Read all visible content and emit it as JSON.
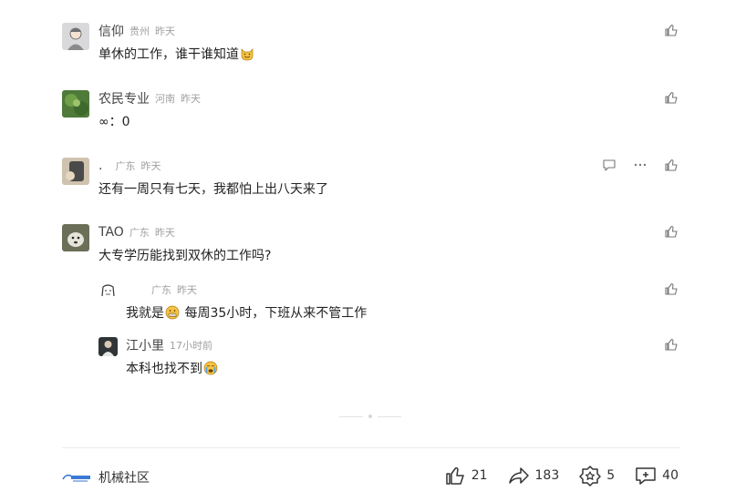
{
  "comments": [
    {
      "name": "信仰",
      "location": "贵州",
      "time": "昨天",
      "text_a": "单休的工作，谁干谁知道",
      "text_b": "",
      "emoji": "cat-grin"
    },
    {
      "name": "农民专业",
      "location": "河南",
      "time": "昨天",
      "text_a": "∞：0",
      "text_b": "",
      "emoji": ""
    },
    {
      "name": ".",
      "location": "广东",
      "time": "昨天",
      "text_a": "还有一周只有七天，我都怕上出八天来了",
      "text_b": "",
      "emoji": ""
    },
    {
      "name": "TAO",
      "location": "广东",
      "time": "昨天",
      "text_a": "大专学历能找到双休的工作吗?",
      "text_b": "",
      "emoji": ""
    }
  ],
  "replies": [
    {
      "name": "",
      "location": "广东",
      "time": "昨天",
      "text_a": "我就是",
      "text_b": "每周35小时，下班从来不管工作",
      "emoji": "grimace"
    },
    {
      "name": "江小里",
      "location": "",
      "time": "17小时前",
      "text_a": "本科也找不到",
      "text_b": "",
      "emoji": "cry"
    }
  ],
  "footer": {
    "source": "机械社区",
    "likes": "21",
    "shares": "183",
    "favorites": "5",
    "comments": "40"
  },
  "colors": {
    "text": "#222222",
    "meta": "#a0a0a0",
    "icon": "#666666"
  }
}
